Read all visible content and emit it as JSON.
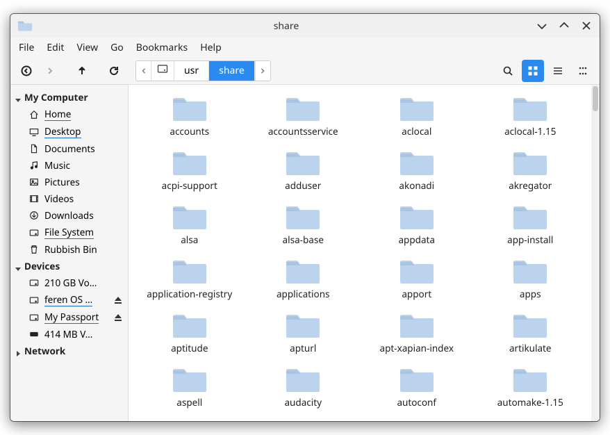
{
  "window": {
    "title": "share"
  },
  "menus": [
    "File",
    "Edit",
    "View",
    "Go",
    "Bookmarks",
    "Help"
  ],
  "path": {
    "segments": [
      "usr",
      "share"
    ],
    "active_index": 1
  },
  "sidebar": {
    "sections": [
      {
        "label": "My Computer",
        "expanded": true,
        "items": [
          {
            "label": "Home",
            "icon": "home",
            "underline": true
          },
          {
            "label": "Desktop",
            "icon": "desktop",
            "underline": true
          },
          {
            "label": "Documents",
            "icon": "document"
          },
          {
            "label": "Music",
            "icon": "music"
          },
          {
            "label": "Pictures",
            "icon": "pictures"
          },
          {
            "label": "Videos",
            "icon": "videos"
          },
          {
            "label": "Downloads",
            "icon": "downloads"
          },
          {
            "label": "File System",
            "icon": "disk",
            "underline": true
          },
          {
            "label": "Rubbish Bin",
            "icon": "trash"
          }
        ]
      },
      {
        "label": "Devices",
        "expanded": true,
        "items": [
          {
            "label": "210 GB Vo…",
            "icon": "disk"
          },
          {
            "label": "feren OS …",
            "icon": "disk",
            "underline": true,
            "eject": true
          },
          {
            "label": "My Passport",
            "icon": "disk",
            "underline": true,
            "eject": true
          },
          {
            "label": "414 MB V…",
            "icon": "drive"
          }
        ]
      },
      {
        "label": "Network",
        "expanded": false,
        "items": []
      }
    ]
  },
  "folders": [
    "accounts",
    "accountsservice",
    "aclocal",
    "aclocal-1.15",
    "acpi-support",
    "adduser",
    "akonadi",
    "akregator",
    "alsa",
    "alsa-base",
    "appdata",
    "app-install",
    "application-registry",
    "applications",
    "apport",
    "apps",
    "aptitude",
    "apturl",
    "apt-xapian-index",
    "artikulate",
    "aspell",
    "audacity",
    "autoconf",
    "automake-1.15"
  ],
  "colors": {
    "accent": "#2b8aef",
    "folder_light": "#bcd3ee",
    "folder_tab": "#a9c5e5"
  }
}
